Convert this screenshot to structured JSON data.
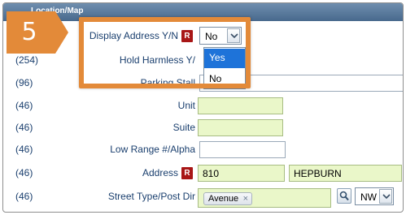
{
  "header": {
    "title": "Location/Map"
  },
  "badges": {
    "required": "R"
  },
  "callout": {
    "number": "5",
    "color": "#E38A39"
  },
  "rows": {
    "display_address": {
      "label": "Display Address Y/N",
      "value": "No",
      "options": [
        "Yes",
        "No"
      ],
      "highlighted_option": "Yes"
    },
    "hold_harmless": {
      "code": "(254)",
      "label": "Hold Harmless Y/"
    },
    "parking_stall": {
      "code": "(96)",
      "label": "Parking Stall"
    },
    "unit": {
      "code": "(46)",
      "label": "Unit",
      "value": ""
    },
    "suite": {
      "code": "(46)",
      "label": "Suite",
      "value": ""
    },
    "low_range": {
      "code": "(46)",
      "label": "Low Range #/Alpha",
      "value": ""
    },
    "address": {
      "code": "(46)",
      "label": "Address",
      "number": "810",
      "street": "HEPBURN"
    },
    "street_type": {
      "code": "(46)",
      "label": "Street Type/Post Dir",
      "tag": "Avenue",
      "tag_remove": "×",
      "post_dir": "NW"
    }
  },
  "colors": {
    "required_field_bg": "#EAF7C9",
    "required_badge": "#A81616",
    "selected_option": "#1E73D9",
    "label_text": "#1A3F6E"
  },
  "icons": {
    "lookup": "magnifier-icon",
    "dropdown": "chevron-down-icon"
  }
}
